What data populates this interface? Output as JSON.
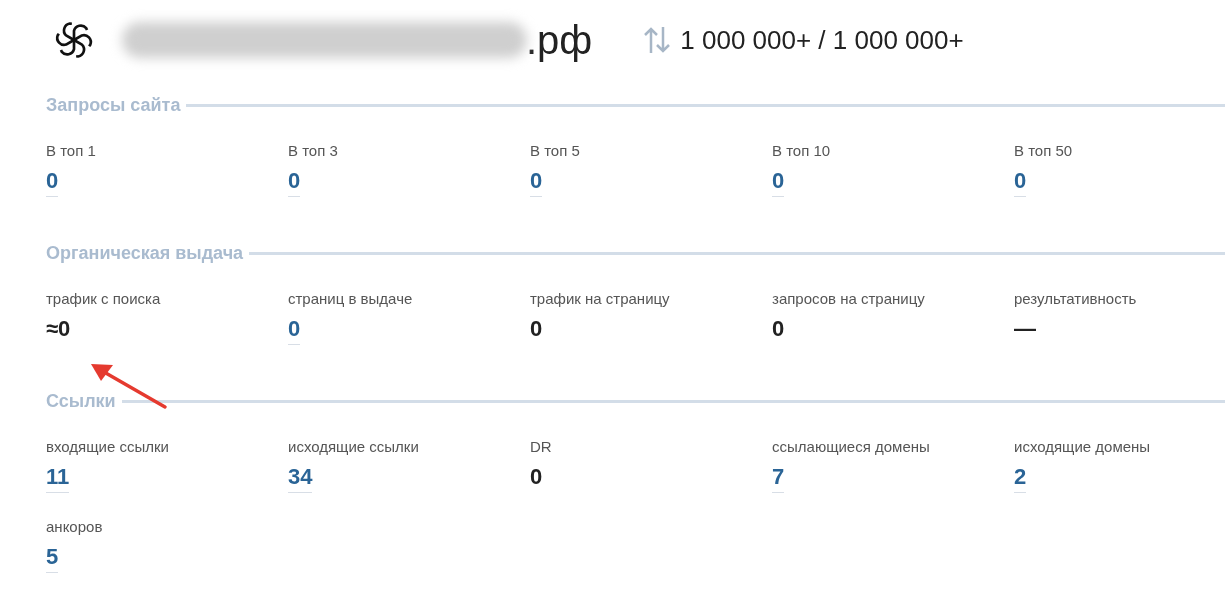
{
  "header": {
    "domain_suffix": ".рф",
    "traffic": "1 000 000+ / 1 000 000+"
  },
  "sections": [
    {
      "title": "Запросы сайта",
      "metrics": [
        {
          "label": "В топ 1",
          "value": "0",
          "kind": "link"
        },
        {
          "label": "В топ 3",
          "value": "0",
          "kind": "link"
        },
        {
          "label": "В топ 5",
          "value": "0",
          "kind": "link"
        },
        {
          "label": "В топ 10",
          "value": "0",
          "kind": "link"
        },
        {
          "label": "В топ 50",
          "value": "0",
          "kind": "link"
        }
      ]
    },
    {
      "title": "Органическая выдача",
      "metrics": [
        {
          "label": "трафик с поиска",
          "value": "≈0",
          "kind": "plain"
        },
        {
          "label": "страниц в выдаче",
          "value": "0",
          "kind": "link"
        },
        {
          "label": "трафик на страницу",
          "value": "0",
          "kind": "plain"
        },
        {
          "label": "запросов на страницу",
          "value": "0",
          "kind": "plain"
        },
        {
          "label": "результативность",
          "value": "—",
          "kind": "plain"
        }
      ]
    },
    {
      "title": "Ссылки",
      "metrics": [
        {
          "label": "входящие ссылки",
          "value": "11",
          "kind": "link"
        },
        {
          "label": "исходящие ссылки",
          "value": "34",
          "kind": "link"
        },
        {
          "label": "DR",
          "value": "0",
          "kind": "plain"
        },
        {
          "label": "ссылающиеся домены",
          "value": "7",
          "kind": "link"
        },
        {
          "label": "исходящие домены",
          "value": "2",
          "kind": "link"
        },
        {
          "label": "анкоров",
          "value": "5",
          "kind": "link"
        }
      ]
    }
  ]
}
